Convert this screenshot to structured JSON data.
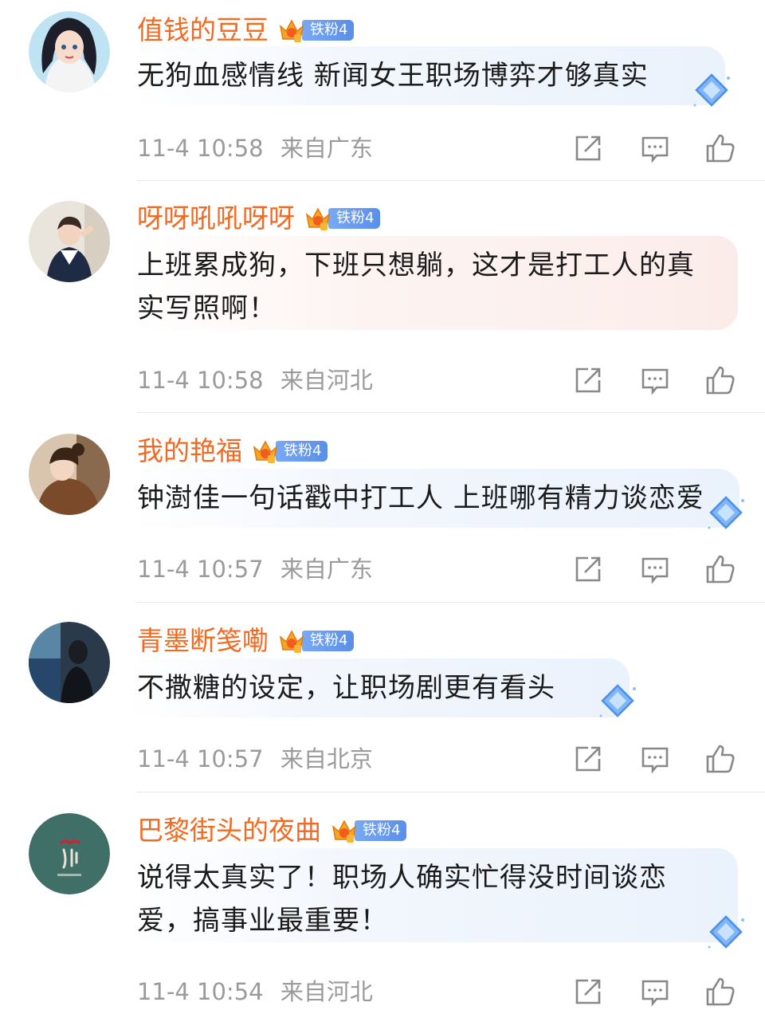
{
  "comments": [
    {
      "username": "值钱的豆豆",
      "badge": "铁粉4",
      "text_lines": [
        "无狗血感情线 新闻女王职场博弈才够真实"
      ],
      "timestamp": "11-4 10:58",
      "location": "来自广东",
      "bubble_style": "blue"
    },
    {
      "username": "呀呀吼吼呀呀",
      "badge": "铁粉4",
      "text_lines": [
        "上班累成狗，下班只想躺，这才是打工人的真",
        "实写照啊！"
      ],
      "timestamp": "11-4 10:58",
      "location": "来自河北",
      "bubble_style": "pink"
    },
    {
      "username": "我的艳福",
      "badge": "铁粉4",
      "text_lines": [
        "钟澍佳一句话戳中打工人 上班哪有精力谈恋爱"
      ],
      "timestamp": "11-4 10:57",
      "location": "来自广东",
      "bubble_style": "blue"
    },
    {
      "username": "青墨断笺嘞",
      "badge": "铁粉4",
      "text_lines": [
        "不撒糖的设定，让职场剧更有看头"
      ],
      "timestamp": "11-4 10:57",
      "location": "来自北京",
      "bubble_style": "blue"
    },
    {
      "username": "巴黎街头的夜曲",
      "badge": "铁粉4",
      "text_lines": [
        "说得太真实了！职场人确实忙得没时间谈恋",
        "爱，搞事业最重要！"
      ],
      "timestamp": "11-4 10:54",
      "location": "来自河北",
      "bubble_style": "blue"
    }
  ],
  "colors": {
    "username": "#f26a21",
    "badge_bg": "#5a8ee8",
    "meta_text": "#9a9a9a",
    "comment_text": "#1b1b1b"
  },
  "icons": {
    "share": "share-icon",
    "reply": "comment-icon",
    "like": "thumbs-up-icon",
    "crown": "crown-icon",
    "gem": "diamond-gem-icon"
  }
}
